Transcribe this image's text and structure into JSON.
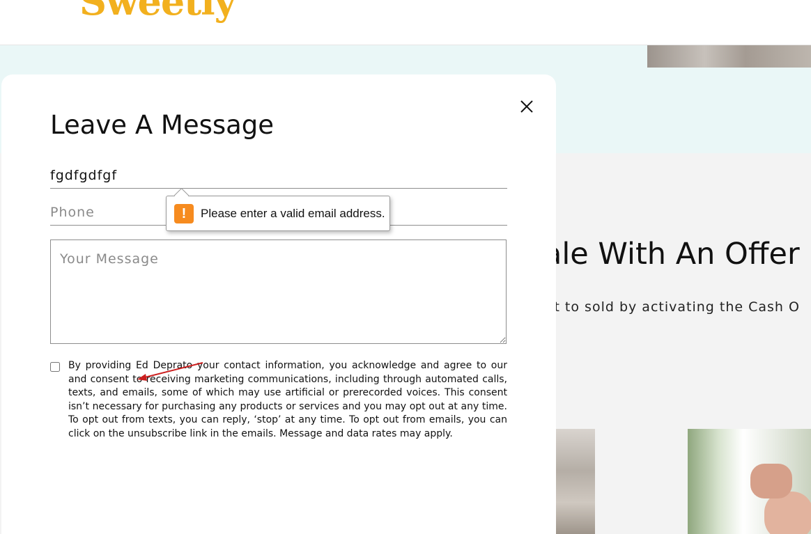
{
  "header": {
    "logo_text": "Sweetly"
  },
  "background": {
    "heading": "ale With An Offer",
    "subheading": "ct to sold by activating the Cash O"
  },
  "modal": {
    "title": "Leave A Message",
    "email_value": "fgdfgdfgf",
    "phone_placeholder": "Phone",
    "message_placeholder": "Your Message",
    "consent_text": "By providing Ed Deprato your contact information, you acknowledge and agree to our and consent to receiving marketing communications, including through automated calls, texts, and emails, some of which may use artificial or prerecorded voices. This consent isn’t necessary for purchasing any products or services and you may opt out at any time. To opt out from texts, you can reply, ‘stop’ at any time. To opt out from emails, you can click on the unsubscribe link in the emails. Message and data rates may apply.",
    "consent_checked": false,
    "close_icon": "close-icon"
  },
  "validation_tooltip": {
    "icon": "warning-icon",
    "message": "Please enter a valid email address."
  },
  "colors": {
    "logo": "#f2b01e",
    "teal_bg": "#eaf7f7",
    "grey_bg": "#f3f3f3",
    "warning": "#f68b1f",
    "annotation_arrow": "#cc1f1f"
  }
}
